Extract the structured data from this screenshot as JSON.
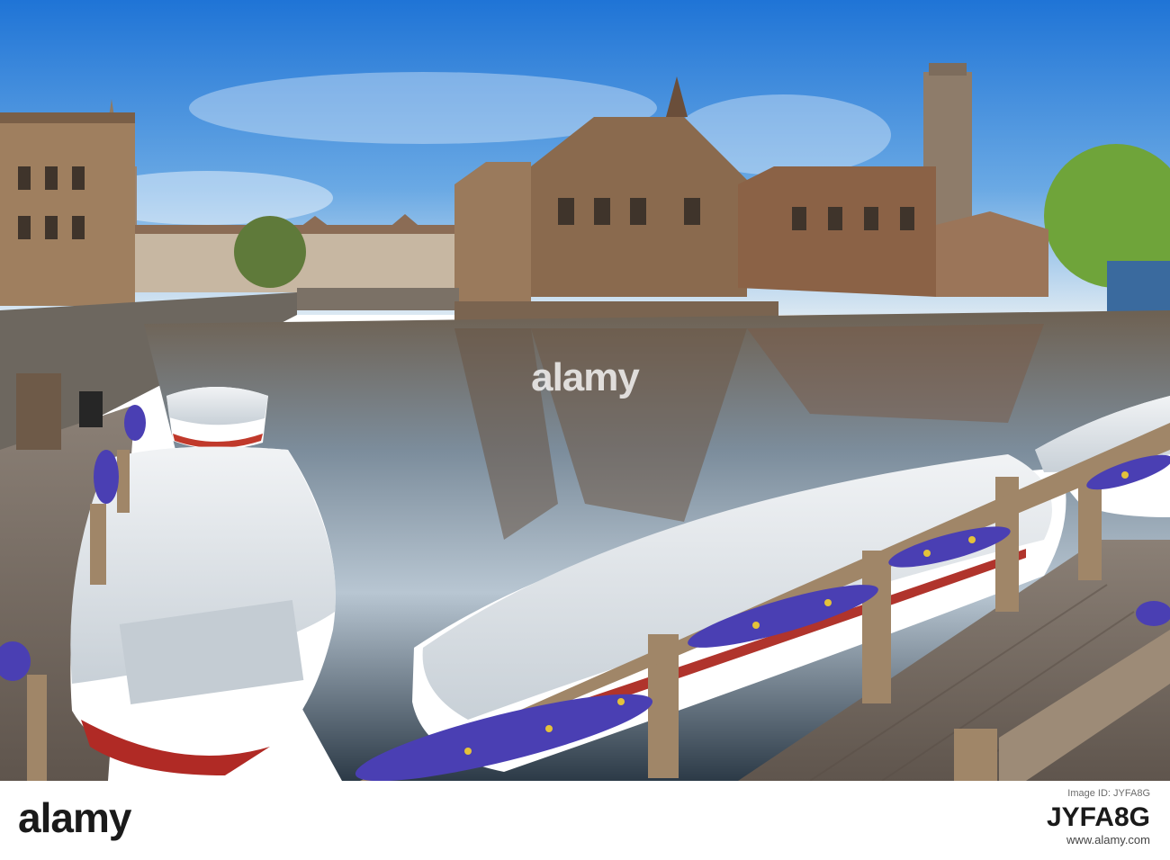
{
  "watermark": {
    "text": "alamy"
  },
  "footer": {
    "brand": "alamy",
    "caption": "Image ID: JYFA8G",
    "image_id": "JYFA8G",
    "website": "www.alamy.com"
  },
  "colors": {
    "sky_top": "#1f78d8",
    "sky_bottom": "#cfe3f3",
    "water": "#33414e",
    "brick": "#8a6a4e",
    "boat_cover": "#dfe4e8",
    "pansy": "#4b3fb0",
    "deck": "#7a6f66"
  }
}
